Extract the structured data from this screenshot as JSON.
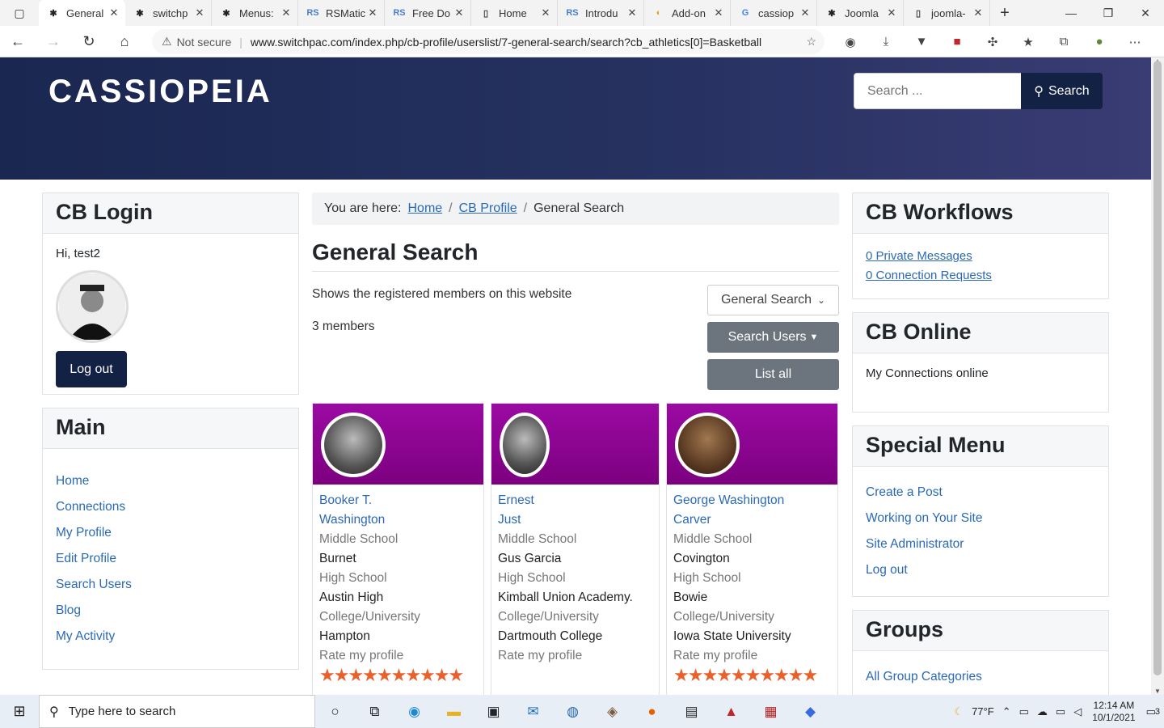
{
  "browser": {
    "tabs": [
      {
        "label": "General",
        "icon": "joomla-icon"
      },
      {
        "label": "switchp",
        "icon": "joomla-icon"
      },
      {
        "label": "Menus:",
        "icon": "joomla-icon"
      },
      {
        "label": "RSMatic",
        "icon": "rs-icon"
      },
      {
        "label": "Free Do",
        "icon": "rs-icon"
      },
      {
        "label": "Home",
        "icon": "page-icon"
      },
      {
        "label": "Introdu",
        "icon": "rs-icon"
      },
      {
        "label": "Add-on",
        "icon": "addon-icon"
      },
      {
        "label": "cassiop",
        "icon": "google-icon"
      },
      {
        "label": "Joomla",
        "icon": "joomla-icon"
      },
      {
        "label": "joomla-",
        "icon": "page-icon"
      }
    ],
    "security_label": "Not secure",
    "url": "www.switchpac.com/index.php/cb-profile/userslist/7-general-search/search?cb_athletics[0]=Basketball"
  },
  "site": {
    "brand": "CASSIOPEIA",
    "search_placeholder": "Search ...",
    "search_button": "Search"
  },
  "login": {
    "title": "CB Login",
    "greeting": "Hi, test2",
    "logout": "Log out"
  },
  "main_menu": {
    "title": "Main",
    "items": [
      "Home",
      "Connections",
      "My Profile",
      "Edit Profile",
      "Search Users",
      "Blog",
      "My Activity"
    ]
  },
  "breadcrumb": {
    "prefix": "You are here:",
    "items": [
      "Home",
      "CB Profile"
    ],
    "current": "General Search"
  },
  "content": {
    "title": "General Search",
    "description": "Shows the registered members on this website",
    "count": "3 members",
    "select_value": "General Search",
    "search_users": "Search Users",
    "list_all": "List all"
  },
  "members": [
    {
      "name_line1": "Booker T.",
      "name_line2": "Washington",
      "rows": [
        {
          "label": "Middle School",
          "value": "Burnet"
        },
        {
          "label": "High School",
          "value": "Austin High"
        },
        {
          "label": "College/University",
          "value": "Hampton"
        }
      ],
      "rate": "Rate my profile"
    },
    {
      "name_line1": "Ernest",
      "name_line2": "Just",
      "rows": [
        {
          "label": "Middle School",
          "value": "Gus Garcia"
        },
        {
          "label": "High School",
          "value": "Kimball Union Academy."
        },
        {
          "label": "College/University",
          "value": "Dartmouth College"
        }
      ],
      "rate": "Rate my profile"
    },
    {
      "name_line1": "George Washington",
      "name_line2": "Carver",
      "rows": [
        {
          "label": "Middle School",
          "value": "Covington"
        },
        {
          "label": "High School",
          "value": "Bowie"
        },
        {
          "label": "College/University",
          "value": "Iowa State University"
        }
      ],
      "rate": "Rate my profile"
    }
  ],
  "workflows": {
    "title": "CB Workflows",
    "items": [
      "0 Private Messages",
      "0 Connection Requests"
    ]
  },
  "online": {
    "title": "CB Online",
    "text": "My Connections online"
  },
  "special_menu": {
    "title": "Special Menu",
    "items": [
      "Create a Post",
      "Working on Your Site",
      "Site Administrator",
      "Log out"
    ]
  },
  "groups": {
    "title": "Groups",
    "items": [
      "All Group Categories"
    ]
  },
  "taskbar": {
    "search_placeholder": "Type here to search",
    "weather": "77°F",
    "time": "12:14 AM",
    "date": "10/1/2021",
    "notifications": "3"
  }
}
